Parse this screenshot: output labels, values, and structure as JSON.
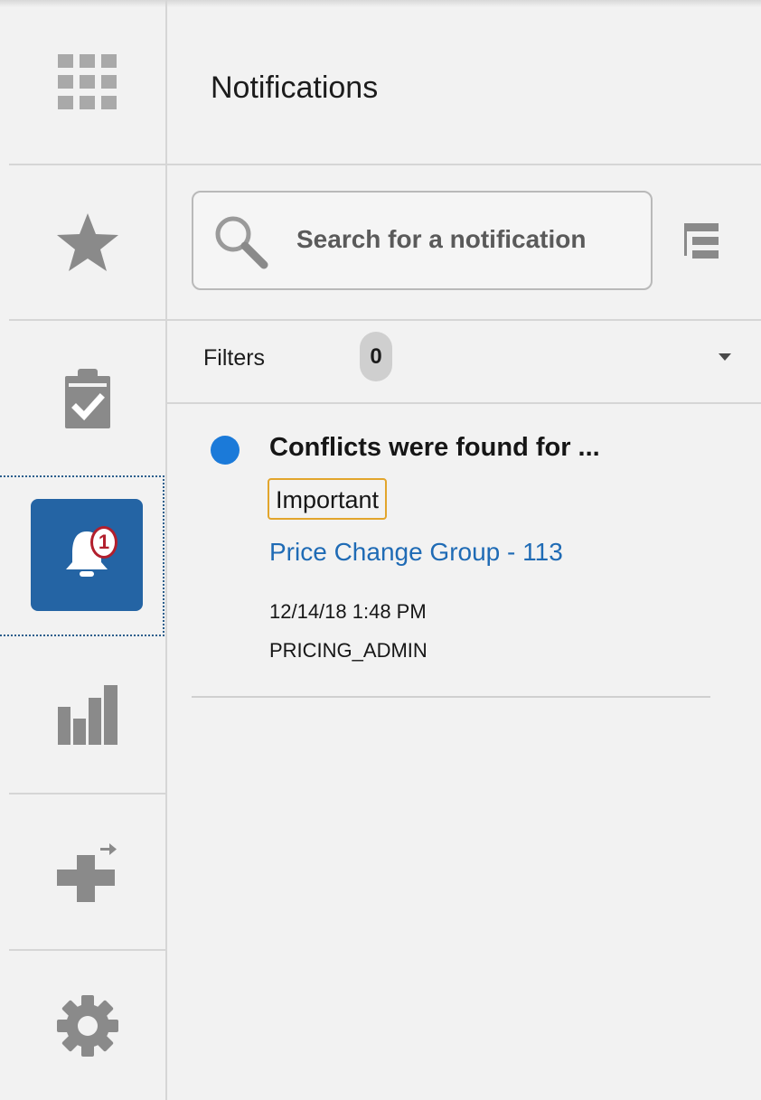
{
  "sidebar": {
    "items": [
      {
        "name": "apps-grid-icon"
      },
      {
        "name": "favorites-star-icon"
      },
      {
        "name": "tasks-clipboard-icon"
      },
      {
        "name": "notifications-bell-icon",
        "badge": "1",
        "selected": true
      },
      {
        "name": "analytics-bar-chart-icon"
      },
      {
        "name": "quick-create-icon"
      },
      {
        "name": "settings-gear-icon"
      }
    ]
  },
  "header": {
    "title": "Notifications"
  },
  "search": {
    "placeholder": "Search for a notification",
    "value": ""
  },
  "filters": {
    "label": "Filters",
    "count": "0"
  },
  "notifications": [
    {
      "title": "Conflicts were found for ...",
      "priority": "Important",
      "link": "Price Change Group - 113",
      "timestamp": "12/14/18 1:48 PM",
      "user": "PRICING_ADMIN",
      "unread": true
    }
  ],
  "colors": {
    "accent": "#2464a4",
    "unread_dot": "#1b7ad9",
    "link": "#1f6bb5",
    "badge_border": "#e2a52c",
    "alert": "#b21f2d"
  }
}
